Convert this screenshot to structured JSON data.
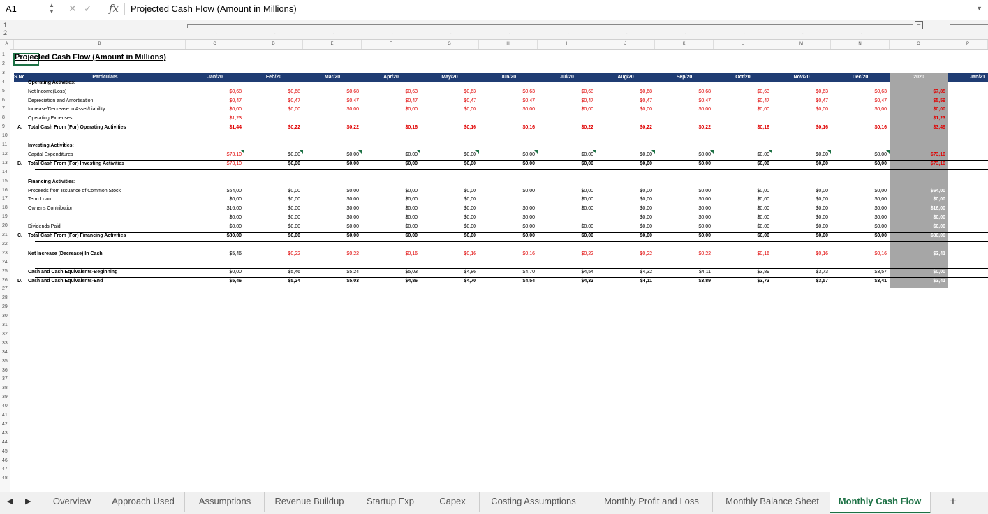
{
  "formula_bar": {
    "cell_ref": "A1",
    "fx": "fx",
    "content": "Projected Cash Flow (Amount in Millions)"
  },
  "columns": [
    "A",
    "B",
    "C",
    "D",
    "E",
    "F",
    "G",
    "H",
    "I",
    "J",
    "K",
    "L",
    "M",
    "N",
    "O",
    "P"
  ],
  "row_numbers": [
    "1",
    "2",
    "3",
    "4",
    "5",
    "6",
    "7",
    "8",
    "9",
    "10",
    "11",
    "12",
    "13",
    "14",
    "15",
    "16",
    "17",
    "18",
    "19",
    "20",
    "21",
    "22",
    "23",
    "24",
    "25",
    "26",
    "27",
    "28",
    "29",
    "30",
    "31",
    "32",
    "33",
    "34",
    "35",
    "36",
    "37",
    "38",
    "39",
    "40",
    "41",
    "42",
    "43",
    "44",
    "45",
    "46",
    "47",
    "48"
  ],
  "sheet": {
    "title": "Projected Cash Flow (Amount in Millions)",
    "header": {
      "sno": "S.No.",
      "particulars": "Particulars",
      "months": [
        "Jan/20",
        "Feb/20",
        "Mar/20",
        "Apr/20",
        "May/20",
        "Jun/20",
        "Jul/20",
        "Aug/20",
        "Sep/20",
        "Oct/20",
        "Nov/20",
        "Dec/20"
      ],
      "year": "2020",
      "next": "Jan/21"
    },
    "operating": {
      "heading": "Operating Activities:",
      "rows": [
        {
          "label": "Net Income(Loss)",
          "values": [
            "$0,68",
            "$0,68",
            "$0,68",
            "$0,63",
            "$0,63",
            "$0,63",
            "$0,68",
            "$0,68",
            "$0,68",
            "$0,63",
            "$0,63",
            "$0,63"
          ],
          "total": "$7,85"
        },
        {
          "label": "Depreciation and Amortisation",
          "values": [
            "$0,47",
            "$0,47",
            "$0,47",
            "$0,47",
            "$0,47",
            "$0,47",
            "$0,47",
            "$0,47",
            "$0,47",
            "$0,47",
            "$0,47",
            "$0,47"
          ],
          "total": "$5,59"
        },
        {
          "label": "Increase/Decrease in Asset/Liability",
          "values": [
            "$0,00",
            "$0,00",
            "$0,00",
            "$0,00",
            "$0,00",
            "$0,00",
            "$0,00",
            "$0,00",
            "$0,00",
            "$0,00",
            "$0,00",
            "$0,00"
          ],
          "total": "$0,00"
        },
        {
          "label": "Operating Expenses",
          "values": [
            "$1,23",
            "",
            "",
            "",
            "",
            "",
            "",
            "",
            "",
            "",
            "",
            ""
          ],
          "total": "$1,23"
        }
      ],
      "total": {
        "sno": "A.",
        "label": "Total Cash From (For) Operating Activities",
        "values": [
          "$1,44",
          "$0,22",
          "$0,22",
          "$0,16",
          "$0,16",
          "$0,16",
          "$0,22",
          "$0,22",
          "$0,22",
          "$0,16",
          "$0,16",
          "$0,16"
        ],
        "total": "$3,49"
      }
    },
    "investing": {
      "heading": "Investing Activities:",
      "rows": [
        {
          "label": "Capital Expenditures",
          "values": [
            "$73,10",
            "$0,00",
            "$0,00",
            "$0,00",
            "$0,00",
            "$0,00",
            "$0,00",
            "$0,00",
            "$0,00",
            "$0,00",
            "$0,00",
            "$0,00"
          ],
          "total": "$73,10"
        }
      ],
      "total": {
        "sno": "B.",
        "label": "Total Cash From (For) Investing Activities",
        "values": [
          "$73,10",
          "$0,00",
          "$0,00",
          "$0,00",
          "$0,00",
          "$0,00",
          "$0,00",
          "$0,00",
          "$0,00",
          "$0,00",
          "$0,00",
          "$0,00"
        ],
        "total": "$73,10"
      }
    },
    "financing": {
      "heading": "Financing Activities:",
      "rows": [
        {
          "label": "Proceeds from Issuance of Common Stock",
          "values": [
            "$64,00",
            "$0,00",
            "$0,00",
            "$0,00",
            "$0,00",
            "$0,00",
            "$0,00",
            "$0,00",
            "$0,00",
            "$0,00",
            "$0,00",
            "$0,00"
          ],
          "total": "$64,00"
        },
        {
          "label": "Term Loan",
          "values": [
            "$0,00",
            "$0,00",
            "$0,00",
            "$0,00",
            "$0,00",
            "",
            "$0,00",
            "$0,00",
            "$0,00",
            "$0,00",
            "$0,00",
            "$0,00"
          ],
          "total": "$0,00"
        },
        {
          "label": "Owner's Contribution",
          "values": [
            "$16,00",
            "$0,00",
            "$0,00",
            "$0,00",
            "$0,00",
            "$0,00",
            "$0,00",
            "$0,00",
            "$0,00",
            "$0,00",
            "$0,00",
            "$0,00"
          ],
          "total": "$16,00"
        },
        {
          "label": "",
          "values": [
            "$0,00",
            "$0,00",
            "$0,00",
            "$0,00",
            "$0,00",
            "$0,00",
            "",
            "$0,00",
            "$0,00",
            "$0,00",
            "$0,00",
            "$0,00"
          ],
          "total": "$0,00"
        },
        {
          "label": "Dividends Paid",
          "values": [
            "$0,00",
            "$0,00",
            "$0,00",
            "$0,00",
            "$0,00",
            "$0,00",
            "$0,00",
            "$0,00",
            "$0,00",
            "$0,00",
            "$0,00",
            "$0,00"
          ],
          "total": "$0,00"
        }
      ],
      "total": {
        "sno": "C.",
        "label": "Total Cash From (For) Financing Activities",
        "values": [
          "$80,00",
          "$0,00",
          "$0,00",
          "$0,00",
          "$0,00",
          "$0,00",
          "$0,00",
          "$0,00",
          "$0,00",
          "$0,00",
          "$0,00",
          "$0,00"
        ],
        "total": "$80,00"
      }
    },
    "net_increase": {
      "label": "Net Increase (Decrease) In Cash",
      "values": [
        "$5,46",
        "$0,22",
        "$0,22",
        "$0,16",
        "$0,16",
        "$0,16",
        "$0,22",
        "$0,22",
        "$0,22",
        "$0,16",
        "$0,16",
        "$0,16"
      ],
      "total": "$3,41"
    },
    "beginning": {
      "label": "Cash and Cash Equivalents-Beginning",
      "values": [
        "$0,00",
        "$5,46",
        "$5,24",
        "$5,03",
        "$4,86",
        "$4,70",
        "$4,54",
        "$4,32",
        "$4,11",
        "$3,89",
        "$3,73",
        "$3,57"
      ],
      "total": "$0,00"
    },
    "ending": {
      "sno": "D.",
      "label": "Cash and Cash Equivalents-End",
      "values": [
        "$5,46",
        "$5,24",
        "$5,03",
        "$4,86",
        "$4,70",
        "$4,54",
        "$4,32",
        "$4,11",
        "$3,89",
        "$3,73",
        "$3,57",
        "$3,41"
      ],
      "total": "$3,41"
    }
  },
  "tabs": [
    "Overview",
    "Approach Used",
    "Assumptions",
    "Revenue Buildup",
    "Startup Exp",
    "Capex",
    "Costing Assumptions",
    "Monthly Profit and Loss",
    "Monthly Balance Sheet",
    "Monthly Cash Flow"
  ],
  "active_tab": "Monthly Cash Flow",
  "colors": {
    "header_bg": "#1f3c73",
    "year_bg": "#a6a6a6",
    "accent": "#1d7145",
    "negative": "#e00000"
  }
}
